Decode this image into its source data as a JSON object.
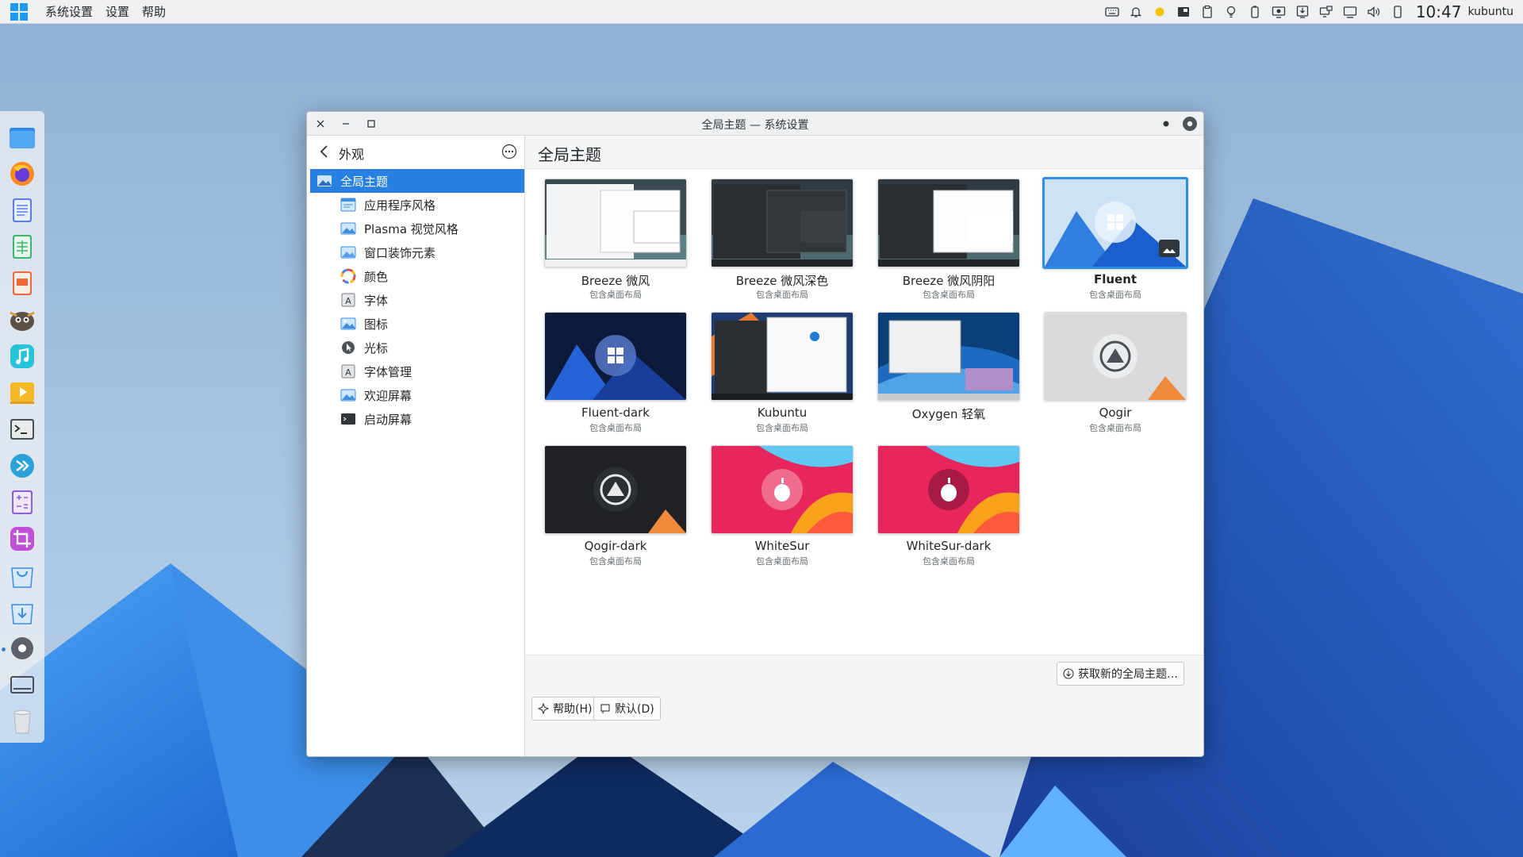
{
  "top_panel": {
    "menu": [
      "系统设置",
      "设置",
      "帮助"
    ],
    "tray_icons": [
      "keyboard-icon",
      "bell-icon",
      "weather-sun-icon",
      "app-icon",
      "clipboard-icon",
      "lightbulb-icon",
      "battery-icon",
      "display-icon",
      "download-icon",
      "display-config-icon",
      "monitor-icon",
      "volume-icon",
      "phone-icon"
    ],
    "clock": "10:47",
    "user": "kubuntu"
  },
  "dock": {
    "items": [
      "file-manager-icon",
      "firefox-icon",
      "writer-icon",
      "calc-icon",
      "impress-icon",
      "gimp-icon",
      "music-icon",
      "video-player-icon",
      "terminal-icon",
      "kdeconnect-icon",
      "calculator-icon",
      "crop-icon",
      "discover-icon",
      "installer-icon",
      "settings-icon",
      "screen-icon",
      "trash-icon"
    ]
  },
  "window": {
    "title": "全局主题 — 系统设置",
    "sidebar": {
      "title": "外观",
      "items": [
        {
          "label": "全局主题",
          "icon": "global-theme-icon",
          "selected": true
        },
        {
          "label": "应用程序风格",
          "icon": "app-style-icon"
        },
        {
          "label": "Plasma 视觉风格",
          "icon": "plasma-style-icon"
        },
        {
          "label": "窗口装饰元素",
          "icon": "window-decoration-icon"
        },
        {
          "label": "颜色",
          "icon": "colors-icon"
        },
        {
          "label": "字体",
          "icon": "fonts-icon"
        },
        {
          "label": "图标",
          "icon": "icons-icon"
        },
        {
          "label": "光标",
          "icon": "cursor-icon"
        },
        {
          "label": "字体管理",
          "icon": "font-manager-icon"
        },
        {
          "label": "欢迎屏幕",
          "icon": "splash-screen-icon"
        },
        {
          "label": "启动屏幕",
          "icon": "boot-screen-icon"
        }
      ]
    },
    "page_title": "全局主题",
    "themes": [
      {
        "name": "Breeze 微风",
        "sub": "包含桌面布局"
      },
      {
        "name": "Breeze 微风深色",
        "sub": "包含桌面布局"
      },
      {
        "name": "Breeze 微风阴阳",
        "sub": "包含桌面布局"
      },
      {
        "name": "Fluent",
        "sub": "包含桌面布局",
        "selected": true
      },
      {
        "name": "Fluent-dark",
        "sub": "包含桌面布局"
      },
      {
        "name": "Kubuntu",
        "sub": "包含桌面布局"
      },
      {
        "name": "Oxygen 轻氧",
        "sub": ""
      },
      {
        "name": "Qogir",
        "sub": "包含桌面布局"
      },
      {
        "name": "Qogir-dark",
        "sub": "包含桌面布局"
      },
      {
        "name": "WhiteSur",
        "sub": "包含桌面布局"
      },
      {
        "name": "WhiteSur-dark",
        "sub": "包含桌面布局"
      }
    ],
    "get_new_button": "获取新的全局主题…",
    "help_button": "帮助(H)",
    "default_button": "默认(D)"
  }
}
